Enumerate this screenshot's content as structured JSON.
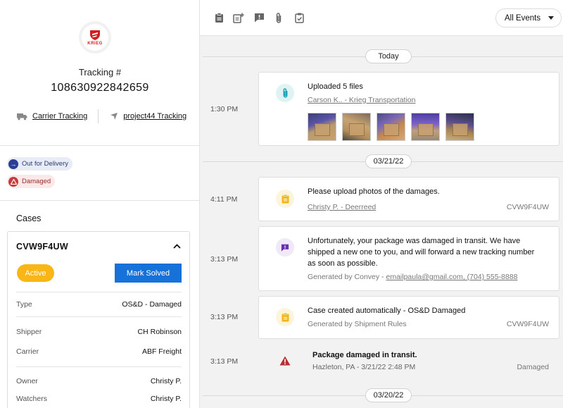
{
  "shipment": {
    "logo_text": "KRIEG",
    "tracking_label": "Tracking #",
    "tracking_number": "108630922842659",
    "carrier_tracking": "Carrier Tracking",
    "p44_tracking": "project44 Tracking",
    "badges": [
      "Out for Delivery",
      "Damaged"
    ]
  },
  "cases": {
    "title": "Cases",
    "case_id": "CVW9F4UW",
    "status": "Active",
    "solve_label": "Mark Solved",
    "rows": [
      {
        "key": "Type",
        "value": "OS&D - Damaged"
      },
      {
        "key": "Shipper",
        "value": "CH Robinson"
      },
      {
        "key": "Carrier",
        "value": "ABF Freight"
      },
      {
        "key": "Owner",
        "value": "Christy P."
      },
      {
        "key": "Watchers",
        "value": "Christy P."
      }
    ]
  },
  "toolbar": {
    "icons": [
      "clipboard-icon",
      "add-note-icon",
      "message-alert-icon",
      "paperclip-icon",
      "checklist-icon"
    ],
    "filter_value": "All Events"
  },
  "timeline": {
    "dates": [
      "Today",
      "03/21/22",
      "03/20/22"
    ],
    "events": [
      {
        "time": "1:30 PM",
        "icon": "paperclip-icon",
        "title": "Uploaded 5 files",
        "sub": "Carson K.. - Krieg Transportation",
        "case": ""
      },
      {
        "time": "4:11 PM",
        "icon": "note-icon",
        "title": "Please upload photos of the damages.",
        "sub": "Christy P. - Deerreed",
        "case": "CVW9F4UW"
      },
      {
        "time": "3:13 PM",
        "icon": "message-alert-icon",
        "lines": [
          "Unfortunately, your package was damaged in transit. We have",
          "shipped a new one to you, and will forward a new tracking number",
          "as soon as possible."
        ],
        "sub_prefix": "Generated by Convey - ",
        "sub_link": "emailpaula@gmail.com, (704) 555-8888"
      },
      {
        "time": "3:13 PM",
        "icon": "note-icon",
        "title": "Case created automatically - OS&D Damaged",
        "sub": "Generated by Shipment Rules",
        "case": "CVW9F4UW"
      },
      {
        "time": "3:13 PM",
        "icon": "warning-icon",
        "title": "Package damaged in transit.",
        "sub": "Hazleton, PA - 3/21/22 2:48 PM",
        "status": "Damaged"
      }
    ]
  },
  "colors": {
    "accent_blue": "#1672d8",
    "active_yellow": "#f8b617",
    "damaged_red": "#c93a3d",
    "delivery_navy": "#2a4193"
  }
}
